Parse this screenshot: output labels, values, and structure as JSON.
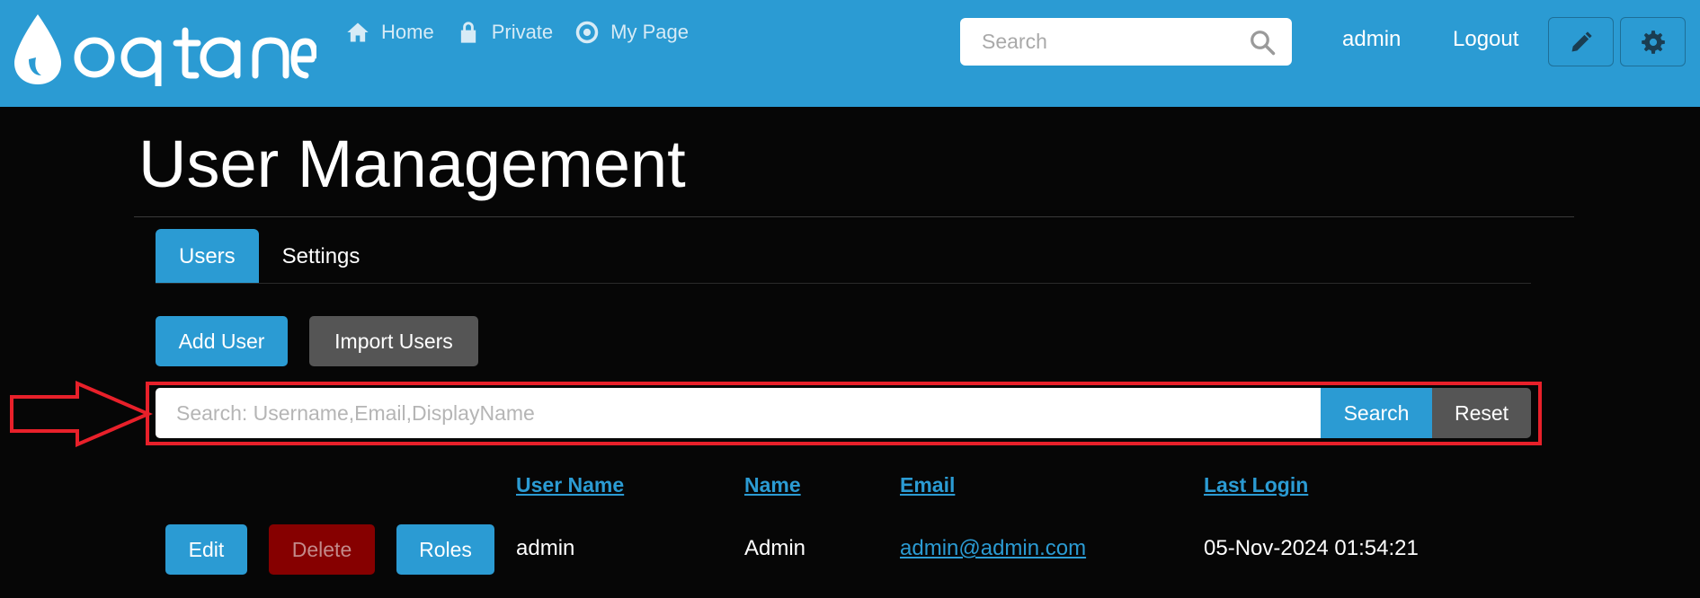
{
  "navbar": {
    "logo_text": "oqtane",
    "links": [
      {
        "label": "Home",
        "icon": "home-icon"
      },
      {
        "label": "Private",
        "icon": "lock-icon"
      },
      {
        "label": "My Page",
        "icon": "target-icon"
      }
    ],
    "search_placeholder": "Search",
    "user": "admin",
    "logout": "Logout",
    "edit_icon": "pencil-icon",
    "settings_icon": "gear-icon"
  },
  "page": {
    "title": "User Management"
  },
  "tabs": [
    {
      "label": "Users",
      "active": true
    },
    {
      "label": "Settings",
      "active": false
    }
  ],
  "actions": {
    "add_user": "Add User",
    "import_users": "Import Users"
  },
  "user_search": {
    "placeholder": "Search: Username,Email,DisplayName",
    "search_button": "Search",
    "reset_button": "Reset"
  },
  "table": {
    "columns": [
      "User Name",
      "Name",
      "Email",
      "Last Login"
    ],
    "rows": [
      {
        "buttons": {
          "edit": "Edit",
          "delete": "Delete",
          "roles": "Roles"
        },
        "username": "admin",
        "name": "Admin",
        "email": "admin@admin.com",
        "last_login": "05-Nov-2024 01:54:21"
      }
    ]
  },
  "colors": {
    "brand": "#2b9bd3",
    "background": "#060606",
    "highlight": "#e8202a",
    "danger": "#860000",
    "secondary": "#555555"
  }
}
